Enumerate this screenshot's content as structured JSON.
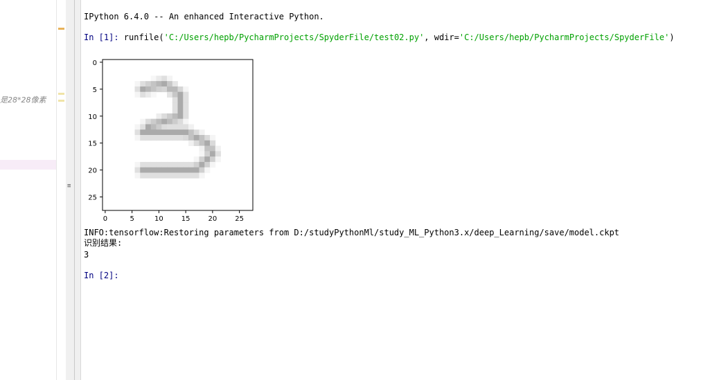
{
  "editor": {
    "comment_fragment": "是28*28像素"
  },
  "console": {
    "banner": "IPython 6.4.0 -- An enhanced Interactive Python.",
    "in1_prompt": "In [1]:",
    "in1_call": " runfile(",
    "in1_arg1": "'C:/Users/hepb/PycharmProjects/SpyderFile/test02.py'",
    "in1_sep": ", wdir=",
    "in1_arg2": "'C:/Users/hepb/PycharmProjects/SpyderFile'",
    "in1_close": ")",
    "info_line": "INFO:tensorflow:Restoring parameters from D:/studyPythonMl/study_ML_Python3.x/deep_Learning/save/model.ckpt",
    "result_label": "识别结果:",
    "result_value": "3",
    "in2_prompt": "In [2]:"
  },
  "chart_data": {
    "type": "heatmap",
    "colormap": "gray_r",
    "x_ticks": [
      0,
      5,
      10,
      15,
      20,
      25
    ],
    "y_ticks": [
      0,
      5,
      10,
      15,
      20,
      25
    ],
    "xlim": [
      -0.5,
      27.5
    ],
    "ylim": [
      27.5,
      -0.5
    ],
    "image_size": [
      28,
      28
    ],
    "grid": false,
    "depicted_digit": "3"
  }
}
